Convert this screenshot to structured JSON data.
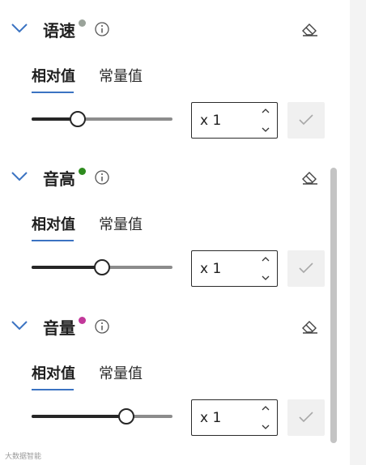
{
  "sections": [
    {
      "title": "语速",
      "status_color": "#9aa39a",
      "tabs": [
        {
          "label": "相对值"
        },
        {
          "label": "常量值"
        }
      ],
      "active_tab": "相对值",
      "slider_level": 0.33,
      "value": "x 1"
    },
    {
      "title": "音高",
      "status_color": "#2e8b1e",
      "tabs": [
        {
          "label": "相对值"
        },
        {
          "label": "常量值"
        }
      ],
      "active_tab": "相对值",
      "slider_level": 0.5,
      "value": "x 1"
    },
    {
      "title": "音量",
      "status_color": "#c2389a",
      "tabs": [
        {
          "label": "相对值"
        },
        {
          "label": "常量值"
        }
      ],
      "active_tab": "相对值",
      "slider_level": 0.67,
      "value": "x 1"
    }
  ],
  "watermark": "大数据智能",
  "icons": {
    "collapse": "chevron-down-icon",
    "info": "info-icon",
    "reset": "eraser-icon",
    "increment": "chevron-up-icon",
    "decrement": "chevron-down-icon",
    "confirm": "checkmark-icon"
  },
  "colors": {
    "accent": "#3b73c2",
    "slider_fill": "#262626",
    "slider_track": "#8c8c8c"
  }
}
